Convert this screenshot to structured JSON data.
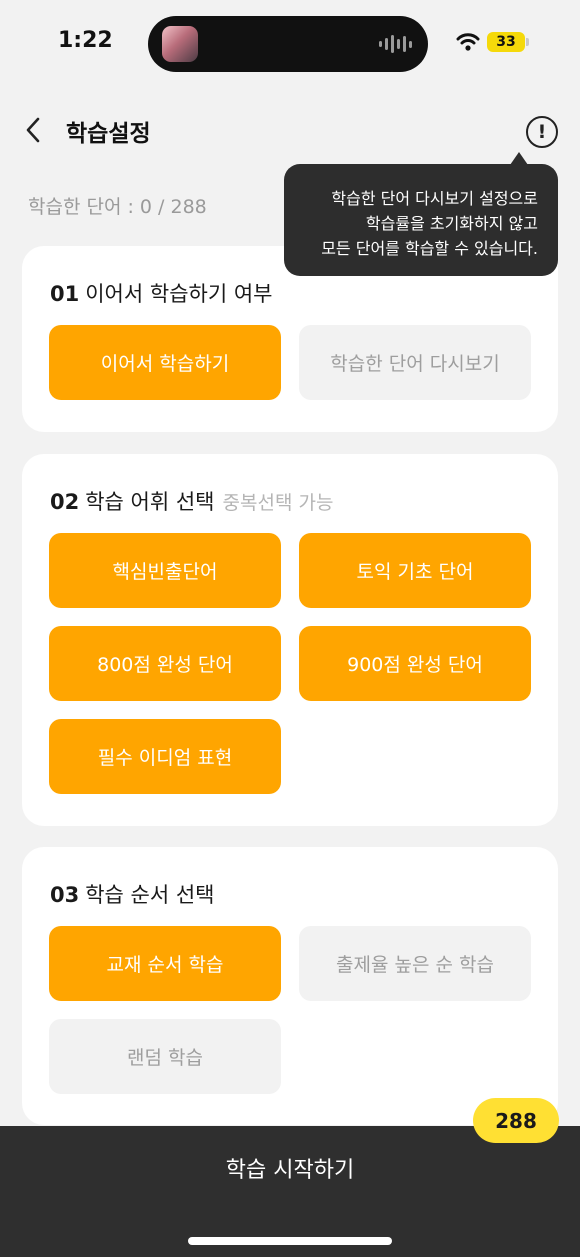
{
  "status_bar": {
    "time": "1:22",
    "battery": "33"
  },
  "header": {
    "title": "학습설정",
    "back_icon": "chevron-left-icon",
    "info_icon": "info-circle-icon",
    "info_glyph": "!"
  },
  "progress": {
    "label": "학습한 단어 : 0 / 288"
  },
  "tooltip": {
    "lines": [
      "학습한 단어 다시보기 설정으로",
      "학습률을 초기화하지 않고",
      "모든 단어를 학습할 수 있습니다."
    ]
  },
  "sections": [
    {
      "num": "01",
      "title": "이어서 학습하기 여부",
      "hint": "",
      "options": [
        {
          "label": "이어서 학습하기",
          "selected": true
        },
        {
          "label": "학습한 단어 다시보기",
          "selected": false
        }
      ]
    },
    {
      "num": "02",
      "title": "학습 어휘 선택",
      "hint": "중복선택 가능",
      "options": [
        {
          "label": "핵심빈출단어",
          "selected": true
        },
        {
          "label": "토익 기초 단어",
          "selected": true
        },
        {
          "label": "800점 완성 단어",
          "selected": true
        },
        {
          "label": "900점 완성 단어",
          "selected": true
        },
        {
          "label": "필수 이디엄 표현",
          "selected": true
        }
      ]
    },
    {
      "num": "03",
      "title": "학습 순서 선택",
      "hint": "",
      "options": [
        {
          "label": "교재 순서 학습",
          "selected": true
        },
        {
          "label": "출제율 높은 순 학습",
          "selected": false
        },
        {
          "label": "랜덤 학습",
          "selected": false
        }
      ]
    }
  ],
  "footer": {
    "start_label": "학습 시작하기",
    "count_badge": "288"
  },
  "colors": {
    "accent": "#ffa500",
    "badge": "#ffe033",
    "tooltip_bg": "#2d2d2d",
    "footer_bg": "#2f2f2f"
  }
}
